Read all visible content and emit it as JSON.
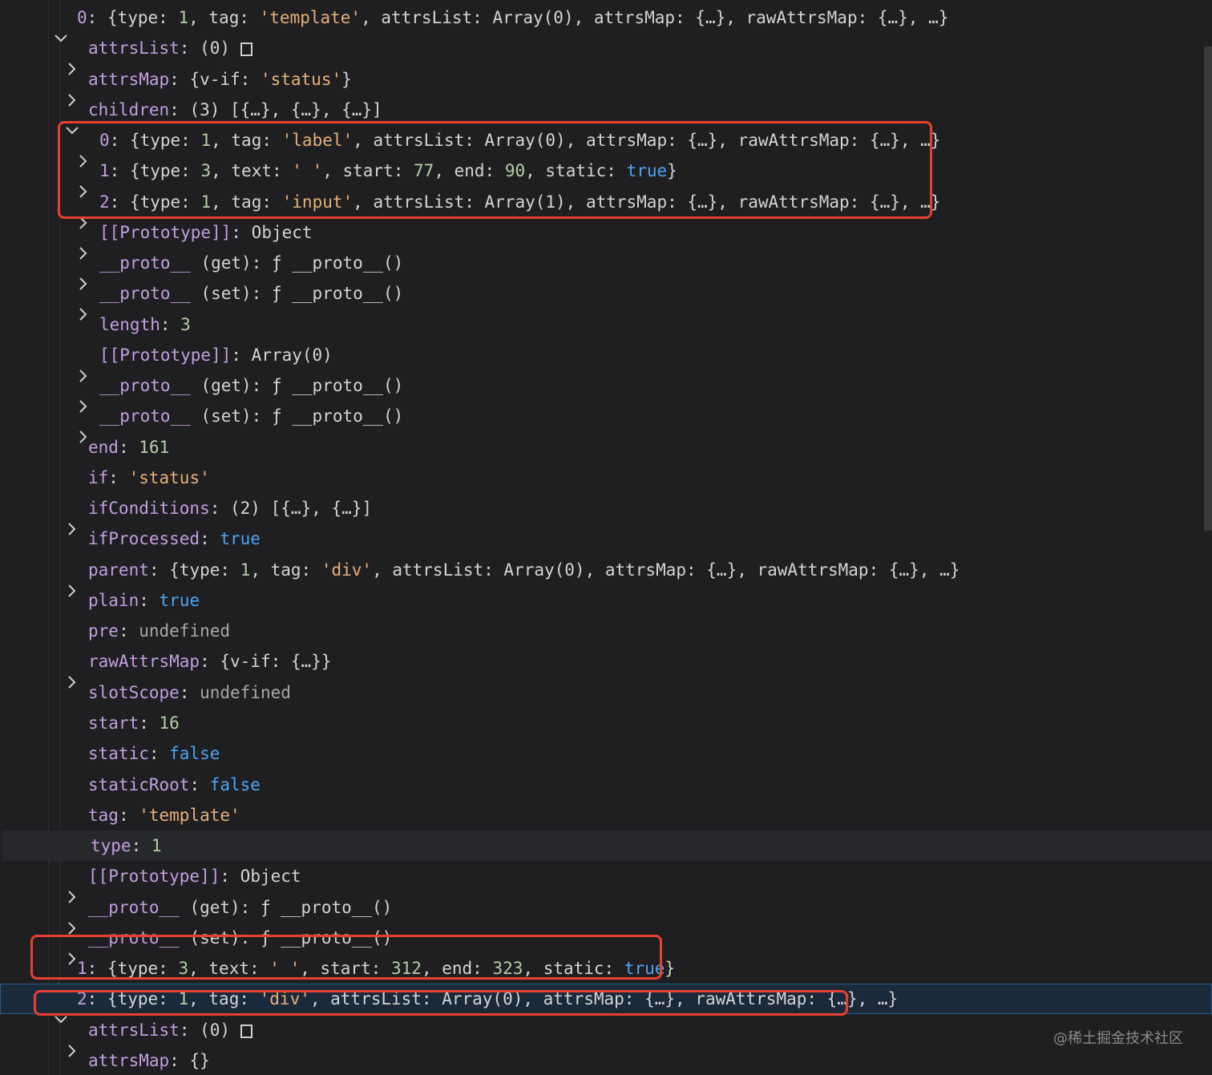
{
  "tree": {
    "rows": [
      {
        "twisty": "open",
        "key": "0",
        "segments": [
          {
            "c": "t",
            "v": "{type: "
          },
          {
            "c": "num",
            "v": "1"
          },
          {
            "c": "t",
            "v": ", tag: "
          },
          {
            "c": "str",
            "v": "'template'"
          },
          {
            "c": "t",
            "v": ", attrsList: Array(0), attrsMap: {…}, rawAttrsMap: {…}, …}"
          }
        ]
      },
      {
        "twisty": "closed",
        "key": "attrsList",
        "segments": [
          {
            "c": "t",
            "v": "(0) "
          }
        ],
        "empty_box": true
      },
      {
        "twisty": "closed",
        "key": "attrsMap",
        "segments": [
          {
            "c": "t",
            "v": "{v-if: "
          },
          {
            "c": "str",
            "v": "'status'"
          },
          {
            "c": "t",
            "v": "}"
          }
        ]
      },
      {
        "twisty": "open",
        "key": "children",
        "segments": [
          {
            "c": "t",
            "v": "(3) [{…}, {…}, {…}]"
          }
        ]
      },
      {
        "twisty": "closed",
        "key": "0",
        "segments": [
          {
            "c": "t",
            "v": "{type: "
          },
          {
            "c": "num",
            "v": "1"
          },
          {
            "c": "t",
            "v": ", tag: "
          },
          {
            "c": "str",
            "v": "'label'"
          },
          {
            "c": "t",
            "v": ", attrsList: Array(0), attrsMap: {…}, rawAttrsMap: {…}, …}"
          }
        ]
      },
      {
        "twisty": "closed",
        "key": "1",
        "segments": [
          {
            "c": "t",
            "v": "{type: "
          },
          {
            "c": "num",
            "v": "3"
          },
          {
            "c": "t",
            "v": ", text: "
          },
          {
            "c": "str",
            "v": "' '"
          },
          {
            "c": "t",
            "v": ", start: "
          },
          {
            "c": "num",
            "v": "77"
          },
          {
            "c": "t",
            "v": ", end: "
          },
          {
            "c": "num",
            "v": "90"
          },
          {
            "c": "t",
            "v": ", static: "
          },
          {
            "c": "bool",
            "v": "true"
          },
          {
            "c": "t",
            "v": "}"
          }
        ]
      },
      {
        "twisty": "closed",
        "key": "2",
        "segments": [
          {
            "c": "t",
            "v": "{type: "
          },
          {
            "c": "num",
            "v": "1"
          },
          {
            "c": "t",
            "v": ", tag: "
          },
          {
            "c": "str",
            "v": "'input'"
          },
          {
            "c": "t",
            "v": ", attrsList: Array(1), attrsMap: {…}, rawAttrsMap: {…}, …}"
          }
        ]
      },
      {
        "twisty": "closed",
        "key": "[[Prototype]]",
        "segments": [
          {
            "c": "t",
            "v": "Object"
          }
        ]
      },
      {
        "twisty": "closed",
        "key": "__proto__",
        "segments": [
          {
            "c": "t",
            "v": "(get): ƒ __proto__()"
          }
        ],
        "key_plain": true
      },
      {
        "twisty": "closed",
        "key": "__proto__",
        "segments": [
          {
            "c": "t",
            "v": "(set): ƒ __proto__()"
          }
        ],
        "key_plain": true
      },
      {
        "twisty": "none",
        "key": "length",
        "segments": [
          {
            "c": "num",
            "v": "3"
          }
        ]
      },
      {
        "twisty": "closed",
        "key": "[[Prototype]]",
        "segments": [
          {
            "c": "t",
            "v": "Array(0)"
          }
        ]
      },
      {
        "twisty": "closed",
        "key": "__proto__",
        "segments": [
          {
            "c": "t",
            "v": "(get): ƒ __proto__()"
          }
        ],
        "key_plain": true
      },
      {
        "twisty": "closed",
        "key": "__proto__",
        "segments": [
          {
            "c": "t",
            "v": "(set): ƒ __proto__()"
          }
        ],
        "key_plain": true
      },
      {
        "twisty": "none",
        "key": "end",
        "segments": [
          {
            "c": "num",
            "v": "161"
          }
        ]
      },
      {
        "twisty": "none",
        "key": "if",
        "segments": [
          {
            "c": "str",
            "v": "'status'"
          }
        ]
      },
      {
        "twisty": "closed",
        "key": "ifConditions",
        "segments": [
          {
            "c": "t",
            "v": "(2) [{…}, {…}]"
          }
        ]
      },
      {
        "twisty": "none",
        "key": "ifProcessed",
        "segments": [
          {
            "c": "bool",
            "v": "true"
          }
        ]
      },
      {
        "twisty": "closed",
        "key": "parent",
        "segments": [
          {
            "c": "t",
            "v": "{type: "
          },
          {
            "c": "num",
            "v": "1"
          },
          {
            "c": "t",
            "v": ", tag: "
          },
          {
            "c": "str",
            "v": "'div'"
          },
          {
            "c": "t",
            "v": ", attrsList: Array(0), attrsMap: {…}, rawAttrsMap: {…}, …}"
          }
        ]
      },
      {
        "twisty": "none",
        "key": "plain",
        "segments": [
          {
            "c": "bool",
            "v": "true"
          }
        ]
      },
      {
        "twisty": "none",
        "key": "pre",
        "segments": [
          {
            "c": "undef",
            "v": "undefined"
          }
        ]
      },
      {
        "twisty": "closed",
        "key": "rawAttrsMap",
        "segments": [
          {
            "c": "t",
            "v": "{v-if: {…}}"
          }
        ]
      },
      {
        "twisty": "none",
        "key": "slotScope",
        "segments": [
          {
            "c": "undef",
            "v": "undefined"
          }
        ]
      },
      {
        "twisty": "none",
        "key": "start",
        "segments": [
          {
            "c": "num",
            "v": "16"
          }
        ]
      },
      {
        "twisty": "none",
        "key": "static",
        "segments": [
          {
            "c": "bool",
            "v": "false"
          }
        ]
      },
      {
        "twisty": "none",
        "key": "staticRoot",
        "segments": [
          {
            "c": "bool",
            "v": "false"
          }
        ]
      },
      {
        "twisty": "none",
        "key": "tag",
        "segments": [
          {
            "c": "str",
            "v": "'template'"
          }
        ]
      },
      {
        "twisty": "none",
        "key": "type",
        "segments": [
          {
            "c": "num",
            "v": "1"
          }
        ]
      },
      {
        "twisty": "closed",
        "key": "[[Prototype]]",
        "segments": [
          {
            "c": "t",
            "v": "Object"
          }
        ]
      },
      {
        "twisty": "closed",
        "key": "__proto__",
        "segments": [
          {
            "c": "t",
            "v": "(get): ƒ __proto__()"
          }
        ],
        "key_plain": true
      },
      {
        "twisty": "closed",
        "key": "__proto__",
        "segments": [
          {
            "c": "t",
            "v": "(set): ƒ __proto__()"
          }
        ],
        "key_plain": true
      },
      {
        "twisty": "closed",
        "key": "1",
        "segments": [
          {
            "c": "t",
            "v": "{type: "
          },
          {
            "c": "num",
            "v": "3"
          },
          {
            "c": "t",
            "v": ", text: "
          },
          {
            "c": "str",
            "v": "' '"
          },
          {
            "c": "t",
            "v": ", start: "
          },
          {
            "c": "num",
            "v": "312"
          },
          {
            "c": "t",
            "v": ", end: "
          },
          {
            "c": "num",
            "v": "323"
          },
          {
            "c": "t",
            "v": ", static: "
          },
          {
            "c": "bool",
            "v": "true"
          },
          {
            "c": "t",
            "v": "}"
          }
        ]
      },
      {
        "twisty": "open",
        "key": "2",
        "segments": [
          {
            "c": "t",
            "v": "{type: "
          },
          {
            "c": "num",
            "v": "1"
          },
          {
            "c": "t",
            "v": ", tag: "
          },
          {
            "c": "str",
            "v": "'div'"
          },
          {
            "c": "t",
            "v": ", attrsList: Array(0), attrsMap: {…}, rawAttrsMap: {…}, …}"
          }
        ]
      },
      {
        "twisty": "closed",
        "key": "attrsList",
        "segments": [
          {
            "c": "t",
            "v": "(0) "
          }
        ],
        "empty_box": true
      },
      {
        "twisty": "closed",
        "key": "attrsMap",
        "segments": [
          {
            "c": "t",
            "v": "{}"
          }
        ]
      }
    ]
  },
  "watermark": "@稀土掘金技术社区",
  "colors": {
    "background": "#1f1f21",
    "key": "#c39fe0",
    "number": "#b5cea8",
    "string": "#e7b07a",
    "boolean": "#4da4f4",
    "highlight_box": "#e8402f",
    "selection": "#1b2a3b"
  }
}
